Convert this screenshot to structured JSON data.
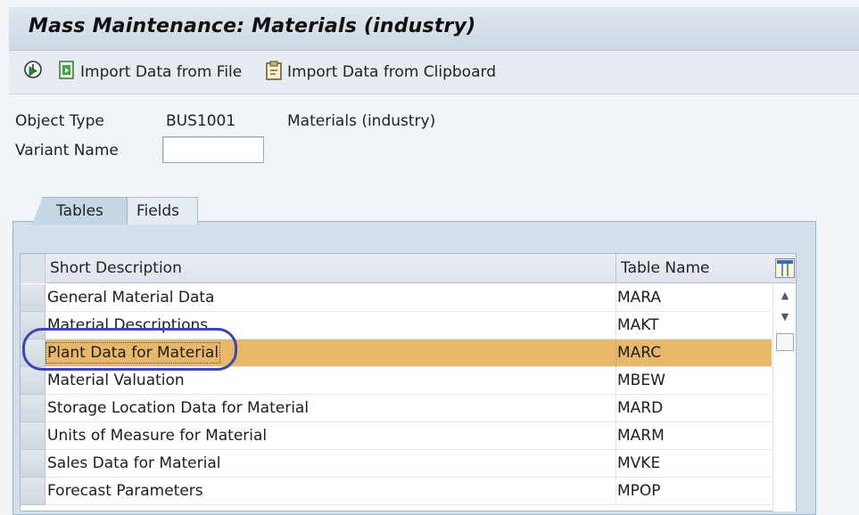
{
  "window": {
    "title": "Mass Maintenance: Materials (industry)"
  },
  "toolbar": {
    "execute_icon": "clock-execute-icon",
    "import_file_label": "Import Data from File",
    "import_clipboard_label": "Import Data from Clipboard"
  },
  "header_form": {
    "object_type_label": "Object Type",
    "object_type_value": "BUS1001",
    "object_type_desc": "Materials (industry)",
    "variant_name_label": "Variant Name",
    "variant_name_value": ""
  },
  "tabs": [
    {
      "label": "Tables",
      "active": true
    },
    {
      "label": "Fields",
      "active": false
    }
  ],
  "table": {
    "columns": [
      "Short Description",
      "Table Name"
    ],
    "rows": [
      {
        "desc": "General Material Data",
        "table": "MARA"
      },
      {
        "desc": "Material Descriptions",
        "table": "MAKT"
      },
      {
        "desc": "Plant Data for Material",
        "table": "MARC",
        "selected": true
      },
      {
        "desc": "Material Valuation",
        "table": "MBEW"
      },
      {
        "desc": "Storage Location Data for Material",
        "table": "MARD"
      },
      {
        "desc": "Units of Measure for Material",
        "table": "MARM"
      },
      {
        "desc": "Sales Data for Material",
        "table": "MVKE"
      },
      {
        "desc": "Forecast Parameters",
        "table": "MPOP"
      }
    ]
  },
  "colors": {
    "selected_row": "#e8b86a",
    "highlight_oval": "#3b46b0"
  }
}
